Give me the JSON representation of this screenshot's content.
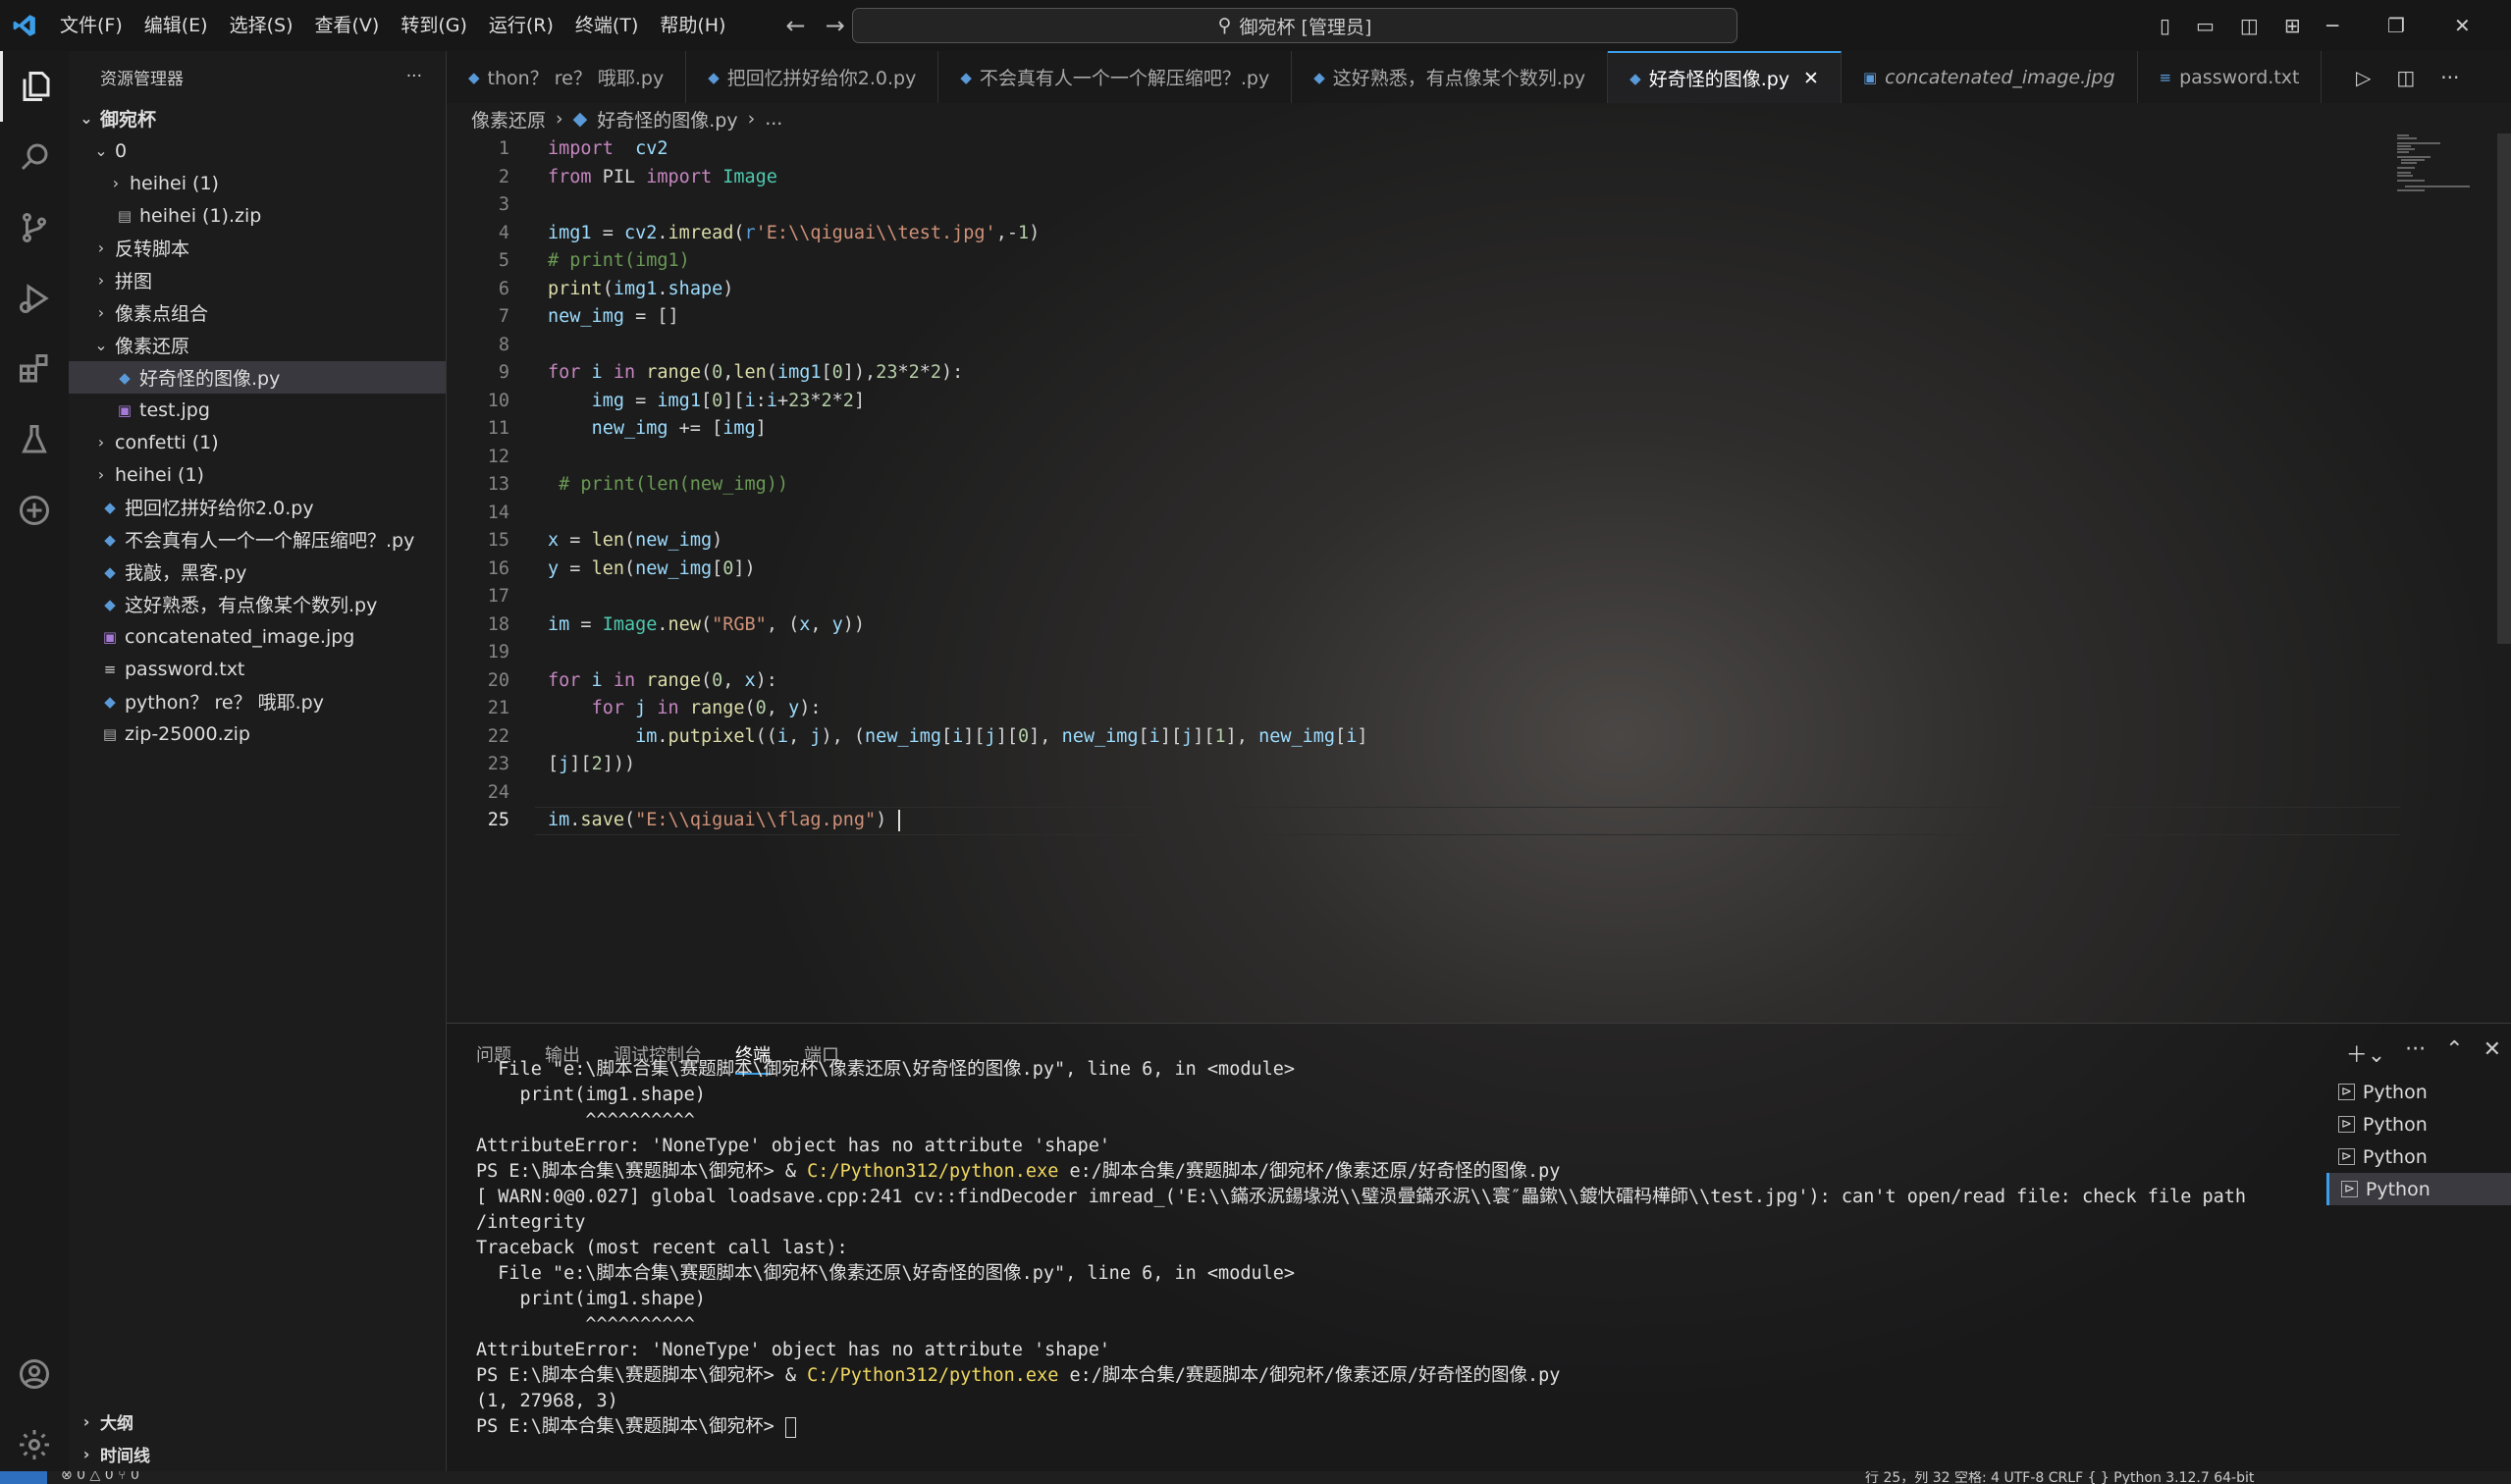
{
  "title_bar": {
    "menus": [
      "文件(F)",
      "编辑(E)",
      "选择(S)",
      "查看(V)",
      "转到(G)",
      "运行(R)",
      "终端(T)",
      "帮助(H)"
    ],
    "search": "御宛杯 [管理员]"
  },
  "explorer": {
    "header": "资源管理器",
    "root": "御宛杯",
    "items": [
      {
        "label": "0",
        "depth": 1,
        "type": "folder",
        "open": true
      },
      {
        "label": "heihei (1)",
        "depth": 2,
        "type": "folder",
        "open": false
      },
      {
        "label": "heihei (1).zip",
        "depth": 2,
        "type": "zip"
      },
      {
        "label": "反转脚本",
        "depth": 1,
        "type": "folder",
        "open": false
      },
      {
        "label": "拼图",
        "depth": 1,
        "type": "folder",
        "open": false
      },
      {
        "label": "像素点组合",
        "depth": 1,
        "type": "folder",
        "open": false
      },
      {
        "label": "像素还原",
        "depth": 1,
        "type": "folder",
        "open": true
      },
      {
        "label": "好奇怪的图像.py",
        "depth": 2,
        "type": "py",
        "selected": true
      },
      {
        "label": "test.jpg",
        "depth": 2,
        "type": "img"
      },
      {
        "label": "confetti (1)",
        "depth": 1,
        "type": "folder",
        "open": false
      },
      {
        "label": "heihei (1)",
        "depth": 1,
        "type": "folder",
        "open": false
      },
      {
        "label": "把回忆拼好给你2.0.py",
        "depth": 1,
        "type": "py"
      },
      {
        "label": "不会真有人一个一个解压缩吧？.py",
        "depth": 1,
        "type": "py"
      },
      {
        "label": "我敲，黑客.py",
        "depth": 1,
        "type": "py"
      },
      {
        "label": "这好熟悉，有点像某个数列.py",
        "depth": 1,
        "type": "py"
      },
      {
        "label": "concatenated_image.jpg",
        "depth": 1,
        "type": "img"
      },
      {
        "label": "password.txt",
        "depth": 1,
        "type": "txt"
      },
      {
        "label": "python？ re？ 哦耶.py",
        "depth": 1,
        "type": "py"
      },
      {
        "label": "zip-25000.zip",
        "depth": 1,
        "type": "zip"
      }
    ],
    "outline": "大纲",
    "timeline": "时间线"
  },
  "tabs": [
    {
      "label": "thon？ re？ 哦耶.py",
      "type": "py"
    },
    {
      "label": "把回忆拼好给你2.0.py",
      "type": "py"
    },
    {
      "label": "不会真有人一个一个解压缩吧？.py",
      "type": "py"
    },
    {
      "label": "这好熟悉，有点像某个数列.py",
      "type": "py"
    },
    {
      "label": "好奇怪的图像.py",
      "type": "py",
      "active": true
    },
    {
      "label": "concatenated_image.jpg",
      "type": "img"
    },
    {
      "label": "password.txt",
      "type": "txt"
    }
  ],
  "breadcrumb": {
    "folder": "像素还原",
    "file": "好奇怪的图像.py",
    "ellipsis": "..."
  },
  "code_lines": [
    [
      [
        "kw",
        "import"
      ],
      [
        "",
        "  "
      ],
      [
        "var",
        "cv2"
      ]
    ],
    [
      [
        "kw",
        "from"
      ],
      [
        "",
        " PIL "
      ],
      [
        "kw",
        "import"
      ],
      [
        "cls",
        " Image"
      ]
    ],
    [],
    [
      [
        "var",
        "img1"
      ],
      [
        "",
        " = "
      ],
      [
        "var",
        "cv2"
      ],
      [
        "",
        "."
      ],
      [
        "fn",
        "imread"
      ],
      [
        "",
        "("
      ],
      [
        "bl",
        "r"
      ],
      [
        "str",
        "'E:\\\\qiguai\\\\test.jpg'"
      ],
      [
        "",
        ",-"
      ],
      [
        "num",
        "1"
      ],
      [
        "",
        ")"
      ]
    ],
    [
      [
        "cm",
        "# print(img1)"
      ]
    ],
    [
      [
        "fn",
        "print"
      ],
      [
        "",
        "("
      ],
      [
        "var",
        "img1"
      ],
      [
        "",
        "."
      ],
      [
        "var",
        "shape"
      ],
      [
        "",
        ")"
      ]
    ],
    [
      [
        "var",
        "new_img"
      ],
      [
        "",
        " = []"
      ]
    ],
    [],
    [
      [
        "kw",
        "for"
      ],
      [
        "var",
        " i "
      ],
      [
        "kw",
        "in"
      ],
      [
        "fn",
        " range"
      ],
      [
        "",
        "("
      ],
      [
        "num",
        "0"
      ],
      [
        "",
        ","
      ],
      [
        "fn",
        "len"
      ],
      [
        "",
        "("
      ],
      [
        "var",
        "img1"
      ],
      [
        "",
        "["
      ],
      [
        "num",
        "0"
      ],
      [
        "",
        "]),"
      ],
      [
        "num",
        "23"
      ],
      [
        "",
        "*"
      ],
      [
        "num",
        "2"
      ],
      [
        "",
        "*"
      ],
      [
        "num",
        "2"
      ],
      [
        "",
        "):"
      ]
    ],
    [
      [
        "",
        "    "
      ],
      [
        "var",
        "img"
      ],
      [
        "",
        " = "
      ],
      [
        "var",
        "img1"
      ],
      [
        "",
        "["
      ],
      [
        "num",
        "0"
      ],
      [
        "",
        "]["
      ],
      [
        "var",
        "i"
      ],
      [
        "",
        ":"
      ],
      [
        "var",
        "i"
      ],
      [
        "",
        "+"
      ],
      [
        "num",
        "23"
      ],
      [
        "",
        "*"
      ],
      [
        "num",
        "2"
      ],
      [
        "",
        "*"
      ],
      [
        "num",
        "2"
      ],
      [
        "",
        "]"
      ]
    ],
    [
      [
        "",
        "    "
      ],
      [
        "var",
        "new_img"
      ],
      [
        "",
        " += ["
      ],
      [
        "var",
        "img"
      ],
      [
        "",
        "]"
      ]
    ],
    [],
    [
      [
        "",
        " "
      ],
      [
        "cm",
        "# print(len(new_img))"
      ]
    ],
    [],
    [
      [
        "var",
        "x"
      ],
      [
        "",
        " = "
      ],
      [
        "fn",
        "len"
      ],
      [
        "",
        "("
      ],
      [
        "var",
        "new_img"
      ],
      [
        "",
        ")"
      ]
    ],
    [
      [
        "var",
        "y"
      ],
      [
        "",
        " = "
      ],
      [
        "fn",
        "len"
      ],
      [
        "",
        "("
      ],
      [
        "var",
        "new_img"
      ],
      [
        "",
        "["
      ],
      [
        "num",
        "0"
      ],
      [
        "",
        "])"
      ]
    ],
    [],
    [
      [
        "var",
        "im"
      ],
      [
        "",
        " = "
      ],
      [
        "cls",
        "Image"
      ],
      [
        "",
        "."
      ],
      [
        "fn",
        "new"
      ],
      [
        "",
        "("
      ],
      [
        "str",
        "\"RGB\""
      ],
      [
        "",
        ", ("
      ],
      [
        "var",
        "x"
      ],
      [
        "",
        ", "
      ],
      [
        "var",
        "y"
      ],
      [
        "",
        "))"
      ]
    ],
    [],
    [
      [
        "kw",
        "for"
      ],
      [
        "var",
        " i "
      ],
      [
        "kw",
        "in"
      ],
      [
        "fn",
        " range"
      ],
      [
        "",
        "("
      ],
      [
        "num",
        "0"
      ],
      [
        "",
        ", "
      ],
      [
        "var",
        "x"
      ],
      [
        "",
        "):"
      ]
    ],
    [
      [
        "",
        "    "
      ],
      [
        "kw",
        "for"
      ],
      [
        "var",
        " j "
      ],
      [
        "kw",
        "in"
      ],
      [
        "fn",
        " range"
      ],
      [
        "",
        "("
      ],
      [
        "num",
        "0"
      ],
      [
        "",
        ", "
      ],
      [
        "var",
        "y"
      ],
      [
        "",
        "):"
      ]
    ],
    [
      [
        "",
        "        "
      ],
      [
        "var",
        "im"
      ],
      [
        "",
        "."
      ],
      [
        "fn",
        "putpixel"
      ],
      [
        "",
        "(("
      ],
      [
        "var",
        "i"
      ],
      [
        "",
        ", "
      ],
      [
        "var",
        "j"
      ],
      [
        "",
        "), ("
      ],
      [
        "var",
        "new_img"
      ],
      [
        "",
        "["
      ],
      [
        "var",
        "i"
      ],
      [
        "",
        "]["
      ],
      [
        "var",
        "j"
      ],
      [
        "",
        "]["
      ],
      [
        "num",
        "0"
      ],
      [
        "",
        "], "
      ],
      [
        "var",
        "new_img"
      ],
      [
        "",
        "["
      ],
      [
        "var",
        "i"
      ],
      [
        "",
        "]["
      ],
      [
        "var",
        "j"
      ],
      [
        "",
        "]["
      ],
      [
        "num",
        "1"
      ],
      [
        "",
        "], "
      ],
      [
        "var",
        "new_img"
      ],
      [
        "",
        "["
      ],
      [
        "var",
        "i"
      ],
      [
        "",
        "]"
      ]
    ],
    [
      [
        "",
        "["
      ],
      [
        "var",
        "j"
      ],
      [
        "",
        "]["
      ],
      [
        "num",
        "2"
      ],
      [
        "",
        "]))"
      ]
    ],
    [],
    [
      [
        "var",
        "im"
      ],
      [
        "",
        "."
      ],
      [
        "fn",
        "save"
      ],
      [
        "",
        "("
      ],
      [
        "str",
        "\"E:\\\\qiguai\\\\flag.png\""
      ],
      [
        "",
        ")"
      ]
    ]
  ],
  "panel": {
    "tabs": [
      "问题",
      "输出",
      "调试控制台",
      "终端",
      "端口"
    ],
    "active_tab": "终端",
    "terminal": [
      [
        [
          "",
          "  File \"e:\\脚本合集\\赛题脚本\\御宛杯\\像素还原\\好奇怪的图像.py\", line 6, in <module>"
        ]
      ],
      [
        [
          "",
          "    print(img1.shape)"
        ]
      ],
      [
        [
          "",
          "          ^^^^^^^^^^"
        ]
      ],
      [
        [
          "",
          "AttributeError: 'NoneType' object has no attribute 'shape'"
        ]
      ],
      [
        [
          "",
          "PS E:\\脚本合集\\赛题脚本\\御宛杯> & "
        ],
        [
          "y",
          "C:/Python312/python.exe"
        ],
        [
          "",
          " e:/脚本合集/赛题脚本/御宛杯/像素还原/好奇怪的图像.py"
        ]
      ],
      [
        [
          "",
          "[ WARN:0@0.027] global loadsave.cpp:241 cv::findDecoder imread_('E:\\\\鏋氶泦鍚堟涚\\\\璧涢曡鏋氶泦\\\\寰″畾鏉\\\\鍍忕礌杩樺師\\\\test.jpg'): can't open/read file: check file path"
        ]
      ],
      [
        [
          "",
          "/integrity"
        ]
      ],
      [
        [
          "",
          "Traceback (most recent call last):"
        ]
      ],
      [
        [
          "",
          "  File \"e:\\脚本合集\\赛题脚本\\御宛杯\\像素还原\\好奇怪的图像.py\", line 6, in <module>"
        ]
      ],
      [
        [
          "",
          "    print(img1.shape)"
        ]
      ],
      [
        [
          "",
          "          ^^^^^^^^^^"
        ]
      ],
      [
        [
          "",
          "AttributeError: 'NoneType' object has no attribute 'shape'"
        ]
      ],
      [
        [
          "",
          "PS E:\\脚本合集\\赛题脚本\\御宛杯> & "
        ],
        [
          "y",
          "C:/Python312/python.exe"
        ],
        [
          "",
          " e:/脚本合集/赛题脚本/御宛杯/像素还原/好奇怪的图像.py"
        ]
      ],
      [
        [
          "",
          "(1, 27968, 3)"
        ]
      ],
      [
        [
          "",
          "PS E:\\脚本合集\\赛题脚本\\御宛杯> "
        ]
      ]
    ],
    "terminals": [
      "Python",
      "Python",
      "Python",
      "Python"
    ]
  },
  "status_bar": {
    "left": "⊗ 0  △ 0     ⑂ 0",
    "right": "行 25，列 32    空格: 4    UTF-8    CRLF    { } Python    3.12.7 64-bit"
  }
}
